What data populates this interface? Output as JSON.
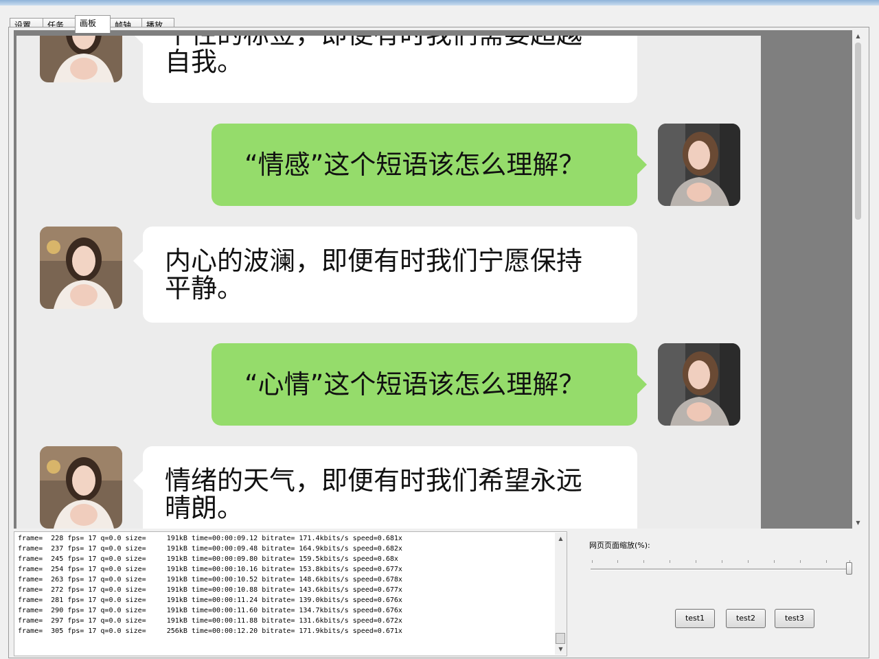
{
  "tabs": [
    {
      "label": "设置"
    },
    {
      "label": "任务"
    },
    {
      "label": "画板"
    },
    {
      "label": "帧轴"
    },
    {
      "label": "播放"
    }
  ],
  "chat": {
    "messages": [
      {
        "side": "left",
        "line1": "个性的标签，即便有时我们需要超越",
        "line2": "自我。"
      },
      {
        "side": "right",
        "text": "“情感”这个短语该怎么理解？"
      },
      {
        "side": "left",
        "line1": "内心的波澜，即便有时我们宁愿保持",
        "line2": "平静。"
      },
      {
        "side": "right",
        "text": "“心情”这个短语该怎么理解？"
      },
      {
        "side": "left",
        "line1": "情绪的天气，即便有时我们希望永远",
        "line2": "晴朗。"
      }
    ]
  },
  "log": {
    "lines": [
      "frame=  228 fps= 17 q=0.0 size=     191kB time=00:00:09.12 bitrate= 171.4kbits/s speed=0.681x",
      "frame=  237 fps= 17 q=0.0 size=     191kB time=00:00:09.48 bitrate= 164.9kbits/s speed=0.682x",
      "frame=  245 fps= 17 q=0.0 size=     191kB time=00:00:09.80 bitrate= 159.5kbits/s speed=0.68x",
      "frame=  254 fps= 17 q=0.0 size=     191kB time=00:00:10.16 bitrate= 153.8kbits/s speed=0.677x",
      "frame=  263 fps= 17 q=0.0 size=     191kB time=00:00:10.52 bitrate= 148.6kbits/s speed=0.678x",
      "frame=  272 fps= 17 q=0.0 size=     191kB time=00:00:10.88 bitrate= 143.6kbits/s speed=0.677x",
      "frame=  281 fps= 17 q=0.0 size=     191kB time=00:00:11.24 bitrate= 139.0kbits/s speed=0.676x",
      "frame=  290 fps= 17 q=0.0 size=     191kB time=00:00:11.60 bitrate= 134.7kbits/s speed=0.676x",
      "frame=  297 fps= 17 q=0.0 size=     191kB time=00:00:11.88 bitrate= 131.6kbits/s speed=0.672x",
      "frame=  305 fps= 17 q=0.0 size=     256kB time=00:00:12.20 bitrate= 171.9kbits/s speed=0.671x"
    ]
  },
  "zoom": {
    "label": "网页页面缩放(%):",
    "level_fraction": 1.0
  },
  "buttons": {
    "test1": "test1",
    "test2": "test2",
    "test3": "test3"
  },
  "colors": {
    "green_bubble": "#95dc6b",
    "white_bubble": "#ffffff",
    "chat_bg": "#ececec"
  },
  "icons": [
    "avatar-left",
    "avatar-right",
    "scroll-up-icon",
    "scroll-down-icon"
  ]
}
